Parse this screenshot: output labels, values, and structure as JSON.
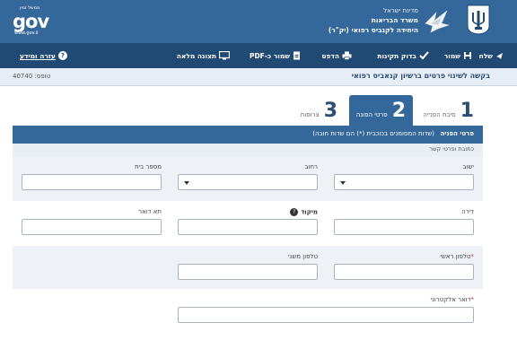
{
  "header": {
    "gov_small": "ממשל זמין",
    "gov_logo": "gov",
    "gov_url": "www.gov.il",
    "ministry_line1": "מדינת ישראל",
    "ministry_line2": "משרד הבריאות",
    "ministry_line3": "היחידה לקנביס רפואי (יק\"ר)",
    "colors": {
      "header_bg": "#35689a",
      "toolbar_bg": "#204a74"
    }
  },
  "toolbar": {
    "send": "שלח",
    "save": "שמור",
    "check": "בדוק תקינות",
    "print": "הדפס",
    "save_pdf": "שמור כ-PDF",
    "full_view": "תצוגה מלאה",
    "help": "עזרה ומידע",
    "help_icon": "?"
  },
  "title": {
    "page_title": "בקשה לשינוי פרטים ברשיון קנאביס רפואי",
    "ref_label": "טופס:",
    "ref_number": "40740"
  },
  "tabs": [
    {
      "num": "1",
      "label": "סיבת הפנייה"
    },
    {
      "num": "2",
      "label": "פרטי הפונה"
    },
    {
      "num": "3",
      "label": "צרופות"
    }
  ],
  "section": {
    "title": "פרטי הפניה",
    "note": "(שדות המסומנים בכוכבית (*) הם שדות חובה)",
    "subtitle": "כתובת ופרטי קשר"
  },
  "fields": {
    "settlement": "ישוב",
    "street": "רחוב",
    "house_number": "מספר בית",
    "apartment": "דירה",
    "zip": "מיקוד",
    "zip_info": "?",
    "po_box": "תא דואר",
    "main_phone": "טלפון ראשי",
    "secondary_phone": "טלפון משני",
    "email": "דואר אלקטרוני",
    "required_mark": "*"
  }
}
